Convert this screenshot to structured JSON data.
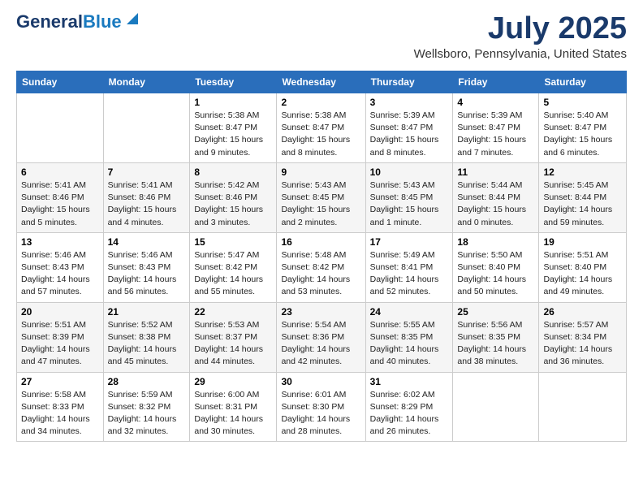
{
  "header": {
    "logo_line1": "General",
    "logo_line2": "Blue",
    "month": "July 2025",
    "location": "Wellsboro, Pennsylvania, United States"
  },
  "days_of_week": [
    "Sunday",
    "Monday",
    "Tuesday",
    "Wednesday",
    "Thursday",
    "Friday",
    "Saturday"
  ],
  "weeks": [
    [
      {
        "num": "",
        "info": ""
      },
      {
        "num": "",
        "info": ""
      },
      {
        "num": "1",
        "info": "Sunrise: 5:38 AM\nSunset: 8:47 PM\nDaylight: 15 hours\nand 9 minutes."
      },
      {
        "num": "2",
        "info": "Sunrise: 5:38 AM\nSunset: 8:47 PM\nDaylight: 15 hours\nand 8 minutes."
      },
      {
        "num": "3",
        "info": "Sunrise: 5:39 AM\nSunset: 8:47 PM\nDaylight: 15 hours\nand 8 minutes."
      },
      {
        "num": "4",
        "info": "Sunrise: 5:39 AM\nSunset: 8:47 PM\nDaylight: 15 hours\nand 7 minutes."
      },
      {
        "num": "5",
        "info": "Sunrise: 5:40 AM\nSunset: 8:47 PM\nDaylight: 15 hours\nand 6 minutes."
      }
    ],
    [
      {
        "num": "6",
        "info": "Sunrise: 5:41 AM\nSunset: 8:46 PM\nDaylight: 15 hours\nand 5 minutes."
      },
      {
        "num": "7",
        "info": "Sunrise: 5:41 AM\nSunset: 8:46 PM\nDaylight: 15 hours\nand 4 minutes."
      },
      {
        "num": "8",
        "info": "Sunrise: 5:42 AM\nSunset: 8:46 PM\nDaylight: 15 hours\nand 3 minutes."
      },
      {
        "num": "9",
        "info": "Sunrise: 5:43 AM\nSunset: 8:45 PM\nDaylight: 15 hours\nand 2 minutes."
      },
      {
        "num": "10",
        "info": "Sunrise: 5:43 AM\nSunset: 8:45 PM\nDaylight: 15 hours\nand 1 minute."
      },
      {
        "num": "11",
        "info": "Sunrise: 5:44 AM\nSunset: 8:44 PM\nDaylight: 15 hours\nand 0 minutes."
      },
      {
        "num": "12",
        "info": "Sunrise: 5:45 AM\nSunset: 8:44 PM\nDaylight: 14 hours\nand 59 minutes."
      }
    ],
    [
      {
        "num": "13",
        "info": "Sunrise: 5:46 AM\nSunset: 8:43 PM\nDaylight: 14 hours\nand 57 minutes."
      },
      {
        "num": "14",
        "info": "Sunrise: 5:46 AM\nSunset: 8:43 PM\nDaylight: 14 hours\nand 56 minutes."
      },
      {
        "num": "15",
        "info": "Sunrise: 5:47 AM\nSunset: 8:42 PM\nDaylight: 14 hours\nand 55 minutes."
      },
      {
        "num": "16",
        "info": "Sunrise: 5:48 AM\nSunset: 8:42 PM\nDaylight: 14 hours\nand 53 minutes."
      },
      {
        "num": "17",
        "info": "Sunrise: 5:49 AM\nSunset: 8:41 PM\nDaylight: 14 hours\nand 52 minutes."
      },
      {
        "num": "18",
        "info": "Sunrise: 5:50 AM\nSunset: 8:40 PM\nDaylight: 14 hours\nand 50 minutes."
      },
      {
        "num": "19",
        "info": "Sunrise: 5:51 AM\nSunset: 8:40 PM\nDaylight: 14 hours\nand 49 minutes."
      }
    ],
    [
      {
        "num": "20",
        "info": "Sunrise: 5:51 AM\nSunset: 8:39 PM\nDaylight: 14 hours\nand 47 minutes."
      },
      {
        "num": "21",
        "info": "Sunrise: 5:52 AM\nSunset: 8:38 PM\nDaylight: 14 hours\nand 45 minutes."
      },
      {
        "num": "22",
        "info": "Sunrise: 5:53 AM\nSunset: 8:37 PM\nDaylight: 14 hours\nand 44 minutes."
      },
      {
        "num": "23",
        "info": "Sunrise: 5:54 AM\nSunset: 8:36 PM\nDaylight: 14 hours\nand 42 minutes."
      },
      {
        "num": "24",
        "info": "Sunrise: 5:55 AM\nSunset: 8:35 PM\nDaylight: 14 hours\nand 40 minutes."
      },
      {
        "num": "25",
        "info": "Sunrise: 5:56 AM\nSunset: 8:35 PM\nDaylight: 14 hours\nand 38 minutes."
      },
      {
        "num": "26",
        "info": "Sunrise: 5:57 AM\nSunset: 8:34 PM\nDaylight: 14 hours\nand 36 minutes."
      }
    ],
    [
      {
        "num": "27",
        "info": "Sunrise: 5:58 AM\nSunset: 8:33 PM\nDaylight: 14 hours\nand 34 minutes."
      },
      {
        "num": "28",
        "info": "Sunrise: 5:59 AM\nSunset: 8:32 PM\nDaylight: 14 hours\nand 32 minutes."
      },
      {
        "num": "29",
        "info": "Sunrise: 6:00 AM\nSunset: 8:31 PM\nDaylight: 14 hours\nand 30 minutes."
      },
      {
        "num": "30",
        "info": "Sunrise: 6:01 AM\nSunset: 8:30 PM\nDaylight: 14 hours\nand 28 minutes."
      },
      {
        "num": "31",
        "info": "Sunrise: 6:02 AM\nSunset: 8:29 PM\nDaylight: 14 hours\nand 26 minutes."
      },
      {
        "num": "",
        "info": ""
      },
      {
        "num": "",
        "info": ""
      }
    ]
  ]
}
